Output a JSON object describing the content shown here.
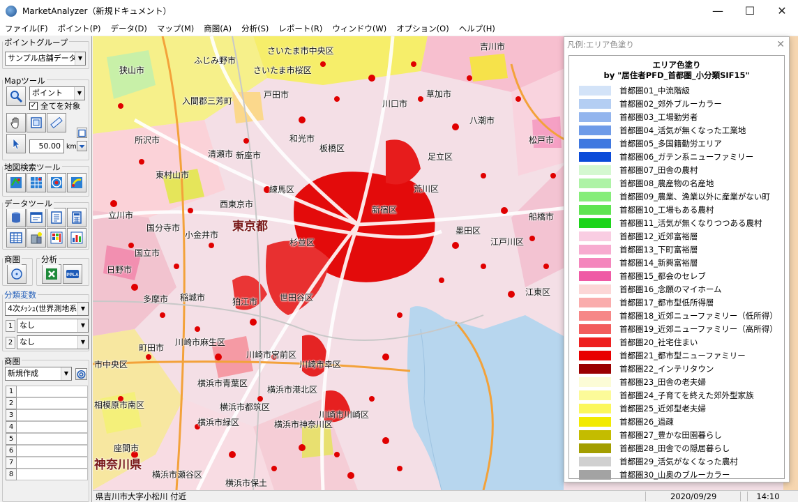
{
  "window": {
    "title": "MarketAnalyzer（新規ドキュメント）",
    "minimize": "—",
    "maximize": "☐",
    "close": "✕"
  },
  "menu": [
    "ファイル(F)",
    "ポイント(P)",
    "データ(D)",
    "マップ(M)",
    "商圏(A)",
    "分析(S)",
    "レポート(R)",
    "ウィンドウ(W)",
    "オプション(O)",
    "ヘルプ(H)"
  ],
  "left_panel": {
    "point_group": {
      "title": "ポイントグループ",
      "value": "サンプル店舗データ2"
    },
    "map_tools": {
      "title": "Mapツール",
      "mode_value": "ポイント",
      "select_all_label": "全てを対象",
      "select_all_checked": true,
      "radius_value": "50.00",
      "radius_unit": "km"
    },
    "search_tools": {
      "title": "地図検索ツール"
    },
    "data_tools": {
      "title": "データツール"
    },
    "trade_area_tools": {
      "title": "商圏"
    },
    "analysis_tools": {
      "title": "分析"
    },
    "class_vars": {
      "title": "分類変数",
      "mesh_value": "4次ﾒｯｼｭ(世界測地系",
      "var1_value": "なし",
      "var2_value": "なし",
      "var1_num": "1",
      "var2_num": "2"
    },
    "trade_area": {
      "title": "商圏",
      "value": "新規作成",
      "rows": [
        "1",
        "2",
        "3",
        "4",
        "5",
        "6",
        "7",
        "8"
      ]
    }
  },
  "map": {
    "labels": {
      "saitama_chuo": "さいたま市中央区",
      "saitama_urawa": "さいたま市桜区",
      "fujimino": "ふじみ野市",
      "sayama": "狭山市",
      "kawagoe": "入間郡三芳町",
      "toda": "戸田市",
      "kawaguchi": "川口市",
      "kusaka": "草加市",
      "yashio": "八潮市",
      "tokorozawa": "所沢市",
      "kiyose": "清瀬市",
      "niiza": "新座市",
      "wako": "和光市",
      "itabashi": "板橋区",
      "adachi": "足立区",
      "matsudo": "松戸市",
      "higashimurayama": "東村山市",
      "nerima": "練馬区",
      "arakawa": "荒川区",
      "nishitokyo": "西東京市",
      "tokyo": "東京都",
      "kokubunji": "国分寺市",
      "koganei": "小金井市",
      "suginami": "杉並区",
      "sumida": "墨田区",
      "edogawa": "江戸川区",
      "tachikawa": "立川市",
      "kunitachi": "国立市",
      "hino": "日野市",
      "koto": "江東区",
      "tama": "多摩市",
      "inagi": "稲城市",
      "setagaya": "世田谷区",
      "komae": "狛江市",
      "machida": "町田市",
      "asao": "川崎市麻生区",
      "miyamae": "川崎市宮前区",
      "kawasaki_saiwai": "川崎市幸区",
      "kawasaki_kawasaki": "川崎市川崎区",
      "aoba": "横浜市青葉区",
      "tsuzuki": "横浜市都筑区",
      "kohoku": "横浜市港北区",
      "midori": "横浜市緑区",
      "kanagawa_ku": "横浜市神奈川区",
      "sagamihara_chuo": "市中央区",
      "sagamihara_minami": "相模原市南区",
      "zama": "座間市",
      "kanagawa": "神奈川県",
      "seya": "横浜市瀬谷区",
      "hodogaya": "横浜市保土",
      "yoshikawa": "吉川市",
      "funabashi": "船橋市",
      "shinjuku": "新宿区"
    }
  },
  "legend": {
    "window_title": "凡例:エリア色塗り",
    "heading_line1": "エリア色塗り",
    "heading_line2": "by \"居住者PFD_首都圏_小分類SIF15\"",
    "items": [
      {
        "label": "首都圏01_中流階級",
        "color": "#d3e3f8"
      },
      {
        "label": "首都圏02_郊外ブルーカラー",
        "color": "#b4cef3"
      },
      {
        "label": "首都圏03_工場勤労者",
        "color": "#93b5ee"
      },
      {
        "label": "首都圏04_活気が無くなった工業地",
        "color": "#6f9be8"
      },
      {
        "label": "首都圏05_多国籍勤労エリア",
        "color": "#3f78e0"
      },
      {
        "label": "首都圏06_ガテン系ニューファミリー",
        "color": "#0b4bd9"
      },
      {
        "label": "首都圏07_田舎の農村",
        "color": "#d4f8d0"
      },
      {
        "label": "首都圏08_農産物の名産地",
        "color": "#aef3a6"
      },
      {
        "label": "首都圏09_農業、漁業以外に産業がない町",
        "color": "#86ed7a"
      },
      {
        "label": "首都圏10_工場もある農村",
        "color": "#5fe452"
      },
      {
        "label": "首都圏11_活気が無くなりつつある農村",
        "color": "#1cd41a"
      },
      {
        "label": "首都圏12_近郊富裕層",
        "color": "#f9cde2"
      },
      {
        "label": "首都圏13_下町富裕層",
        "color": "#f7abd0"
      },
      {
        "label": "首都圏14_新興富裕層",
        "color": "#f486bd"
      },
      {
        "label": "首都圏15_都会のセレブ",
        "color": "#ef5aa5"
      },
      {
        "label": "首都圏16_念願のマイホーム",
        "color": "#fcd6d6"
      },
      {
        "label": "首都圏17_都市型低所得層",
        "color": "#faacac"
      },
      {
        "label": "首都圏18_近郊ニューファミリー（低所得）",
        "color": "#f68787"
      },
      {
        "label": "首都圏19_近郊ニューファミリー（高所得）",
        "color": "#f25d5d"
      },
      {
        "label": "首都圏20_社宅住まい",
        "color": "#ee2020"
      },
      {
        "label": "首都圏21_都市型ニューファミリー",
        "color": "#e80000"
      },
      {
        "label": "首都圏22_インテリタウン",
        "color": "#9a0000"
      },
      {
        "label": "首都圏23_田舎の老夫婦",
        "color": "#fcfcd6"
      },
      {
        "label": "首都圏24_子育てを終えた郊外型家族",
        "color": "#fcfa99"
      },
      {
        "label": "首都圏25_近郊型老夫婦",
        "color": "#fbf75c"
      },
      {
        "label": "首都圏26_過疎",
        "color": "#f2ea00"
      },
      {
        "label": "首都圏27_豊かな田園暮らし",
        "color": "#c4bc00"
      },
      {
        "label": "首都圏28_田舎での隠居暮らし",
        "color": "#a39e00"
      },
      {
        "label": "首都圏29_活気がなくなった農村",
        "color": "#d0d0d0"
      },
      {
        "label": "首都圏30_山奥のブルーカラー",
        "color": "#a3a3a3"
      }
    ]
  },
  "status": {
    "address": "県吉川市大字小松川 付近",
    "date": "2020/09/29",
    "time": "14:10"
  }
}
